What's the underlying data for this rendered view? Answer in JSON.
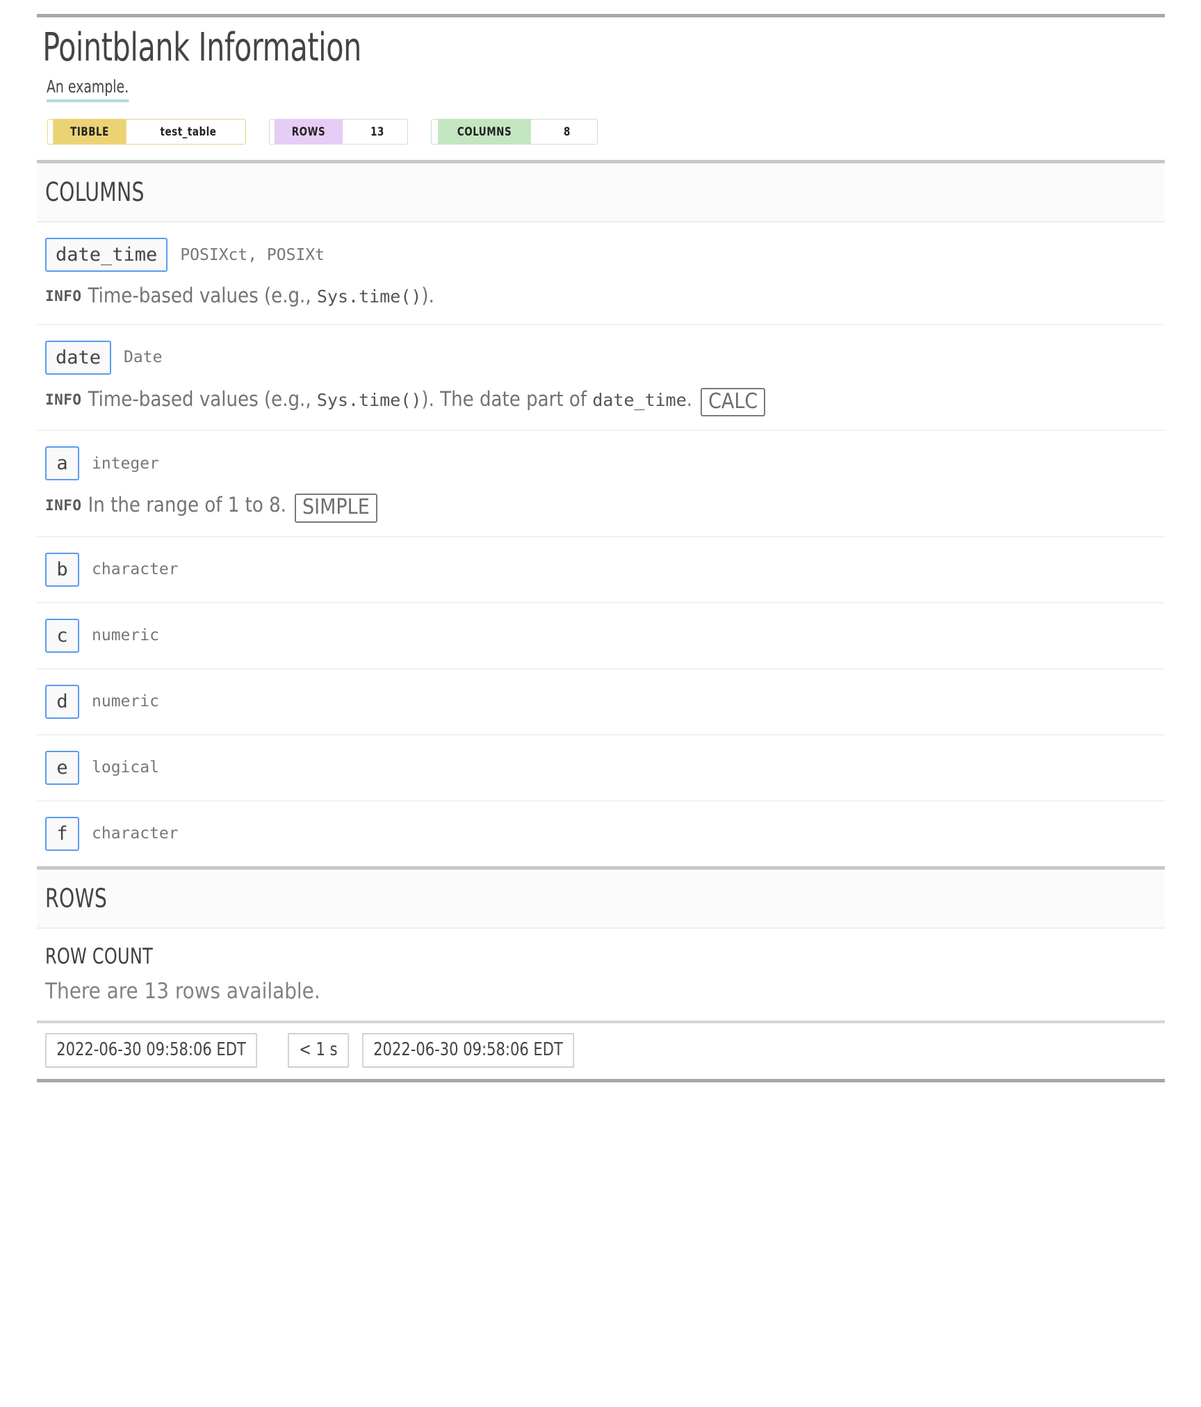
{
  "report": {
    "title": "Pointblank Information",
    "subtitle": "An example."
  },
  "badges": [
    {
      "key": "TIBBLE",
      "value": "test_table",
      "key_color": "#EBD375",
      "border_color": "#E8D67C"
    },
    {
      "key": "ROWS",
      "value": "13",
      "key_color": "#E6CDF5",
      "border_color": "#E6CDF5"
    },
    {
      "key": "COLUMNS",
      "value": "8",
      "key_color": "#C3E6C0",
      "border_color": "#C3E6C0"
    }
  ],
  "columns_section": {
    "heading": "COLUMNS",
    "info_label": "INFO",
    "rows": [
      {
        "name": "date_time",
        "type": "POSIXct, POSIXt",
        "info_pre": "Time-based values (e.g., ",
        "info_code": "Sys.time()",
        "info_post": ").",
        "info_tail": "",
        "tail_code": "",
        "tail_post": "",
        "tag": ""
      },
      {
        "name": "date",
        "type": "Date",
        "info_pre": "Time-based values (e.g., ",
        "info_code": "Sys.time()",
        "info_post": "). The date part of ",
        "info_tail": "",
        "tail_code": "date_time",
        "tail_post": ".",
        "tag": "CALC"
      },
      {
        "name": "a",
        "type": "integer",
        "info_pre": "In the range of 1 to 8.",
        "info_code": "",
        "info_post": "",
        "info_tail": "",
        "tail_code": "",
        "tail_post": "",
        "tag": "SIMPLE"
      },
      {
        "name": "b",
        "type": "character",
        "info_pre": "",
        "info_code": "",
        "info_post": "",
        "info_tail": "",
        "tail_code": "",
        "tail_post": "",
        "tag": ""
      },
      {
        "name": "c",
        "type": "numeric",
        "info_pre": "",
        "info_code": "",
        "info_post": "",
        "info_tail": "",
        "tail_code": "",
        "tail_post": "",
        "tag": ""
      },
      {
        "name": "d",
        "type": "numeric",
        "info_pre": "",
        "info_code": "",
        "info_post": "",
        "info_tail": "",
        "tail_code": "",
        "tail_post": "",
        "tag": ""
      },
      {
        "name": "e",
        "type": "logical",
        "info_pre": "",
        "info_code": "",
        "info_post": "",
        "info_tail": "",
        "tail_code": "",
        "tail_post": "",
        "tag": ""
      },
      {
        "name": "f",
        "type": "character",
        "info_pre": "",
        "info_code": "",
        "info_post": "",
        "info_tail": "",
        "tail_code": "",
        "tail_post": "",
        "tag": ""
      }
    ]
  },
  "rows_section": {
    "heading": "ROWS",
    "subheading": "ROW COUNT",
    "description": "There are 13 rows available."
  },
  "footer": {
    "start_time": "2022-06-30 09:58:06 EDT",
    "duration": "< 1 s",
    "end_time": "2022-06-30 09:58:06 EDT"
  }
}
